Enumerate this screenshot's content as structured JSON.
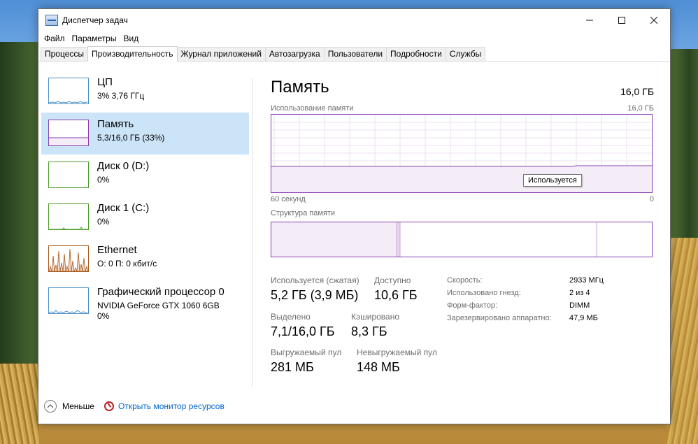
{
  "window": {
    "title": "Диспетчер задач",
    "minimize_icon": "minimize-icon",
    "maximize_icon": "maximize-icon",
    "close_icon": "close-icon"
  },
  "menu": [
    "Файл",
    "Параметры",
    "Вид"
  ],
  "tabs": [
    "Процессы",
    "Производительность",
    "Журнал приложений",
    "Автозагрузка",
    "Пользователи",
    "Подробности",
    "Службы"
  ],
  "active_tab": "Производительность",
  "sidebar": {
    "items": [
      {
        "name": "ЦП",
        "line1": "3% 3,76 ГГц",
        "line2": "",
        "color": "#4a90c8"
      },
      {
        "name": "Память",
        "line1": "5,3/16,0 ГБ (33%)",
        "line2": "",
        "color": "#8b3db0"
      },
      {
        "name": "Диск 0 (D:)",
        "line1": "0%",
        "line2": "",
        "color": "#4c9a2a"
      },
      {
        "name": "Диск 1 (C:)",
        "line1": "0%",
        "line2": "",
        "color": "#4c9a2a"
      },
      {
        "name": "Ethernet",
        "line1": "О: 0 П: 0 кбит/с",
        "line2": "",
        "color": "#a7581b"
      },
      {
        "name": "Графический процессор 0",
        "line1": "NVIDIA GeForce GTX 1060 6GB",
        "line2": "0%",
        "color": "#4a90c8"
      }
    ]
  },
  "memory": {
    "title": "Память",
    "total": "16,0 ГБ",
    "usage_label": "Использование памяти",
    "usage_max": "16,0 ГБ",
    "usage_fraction": 0.33,
    "axis_left": "60 секунд",
    "axis_right": "0",
    "composition_label": "Структура памяти",
    "tooltip": "Используется",
    "stats": {
      "in_use_label": "Используется (сжатая)",
      "in_use_value": "5,2 ГБ (3,9 МБ)",
      "available_label": "Доступно",
      "available_value": "10,6 ГБ",
      "committed_label": "Выделено",
      "committed_value": "7,1/16,0 ГБ",
      "cached_label": "Кэшировано",
      "cached_value": "8,3 ГБ",
      "paged_label": "Выгружаемый пул",
      "paged_value": "281 МБ",
      "nonpaged_label": "Невыгружаемый пул",
      "nonpaged_value": "148 МБ"
    },
    "details": [
      {
        "key": "Скорость:",
        "value": "2933 МГц"
      },
      {
        "key": "Использовано гнезд:",
        "value": "2 из 4"
      },
      {
        "key": "Форм-фактор:",
        "value": "DIMM"
      },
      {
        "key": "Зарезервировано аппаратно:",
        "value": "47,9 МБ"
      }
    ]
  },
  "footer": {
    "less_label": "Меньше",
    "monitor_label": "Открыть монитор ресурсов"
  }
}
